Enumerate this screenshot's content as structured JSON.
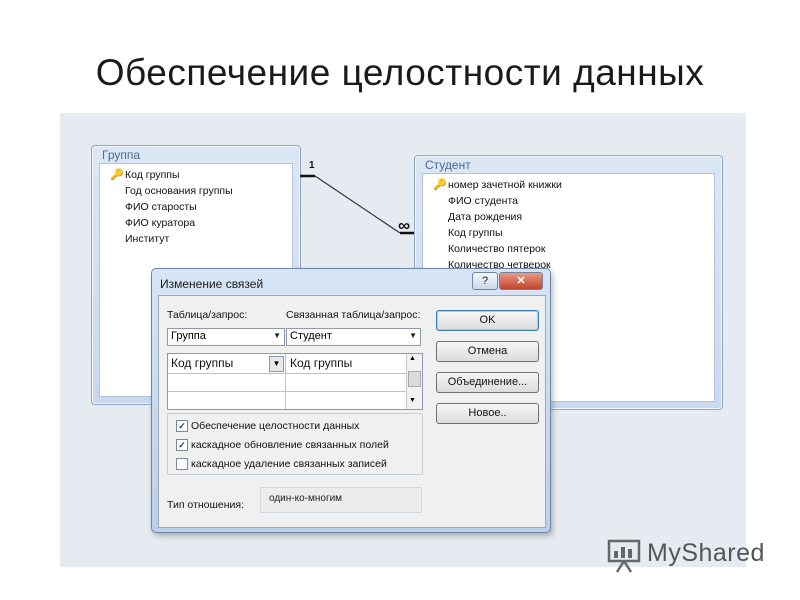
{
  "slide": {
    "title": "Обеспечение целостности данных"
  },
  "table_group": {
    "title": "Группа",
    "fields": [
      "Код группы",
      "Год основания группы",
      "ФИО старосты",
      "ФИО куратора",
      "Институт"
    ]
  },
  "table_student": {
    "title": "Студент",
    "fields": [
      "номер зачетной книжки",
      "ФИО студента",
      "Дата рождения",
      "Код группы",
      "Количество пятерок",
      "Количество четверок"
    ]
  },
  "relationship": {
    "one_symbol": "1",
    "many_symbol": "∞"
  },
  "dialog": {
    "title": "Изменение связей",
    "help_label": "?",
    "close_label": "✕",
    "table_label": "Таблица/запрос:",
    "related_label": "Связанная таблица/запрос:",
    "table_value": "Группа",
    "related_value": "Студент",
    "field_left": "Код группы",
    "field_right": "Код группы",
    "buttons": {
      "ok": "OK",
      "cancel": "Отмена",
      "join": "Объединение...",
      "new": "Новое.."
    },
    "checkboxes": [
      {
        "label": "Обеспечение целостности данных",
        "checked": true
      },
      {
        "label": "каскадное обновление связанных полей",
        "checked": true
      },
      {
        "label": "каскадное удаление связанных записей",
        "checked": false
      }
    ],
    "rel_type_label": "Тип отношения:",
    "rel_type_value": "один-ко-многим"
  },
  "watermark": {
    "text": "MyShared"
  },
  "colors": {
    "accent": "#3c7fb1",
    "window_border": "#8fa6c4",
    "canvas": "#e6ebf2"
  }
}
